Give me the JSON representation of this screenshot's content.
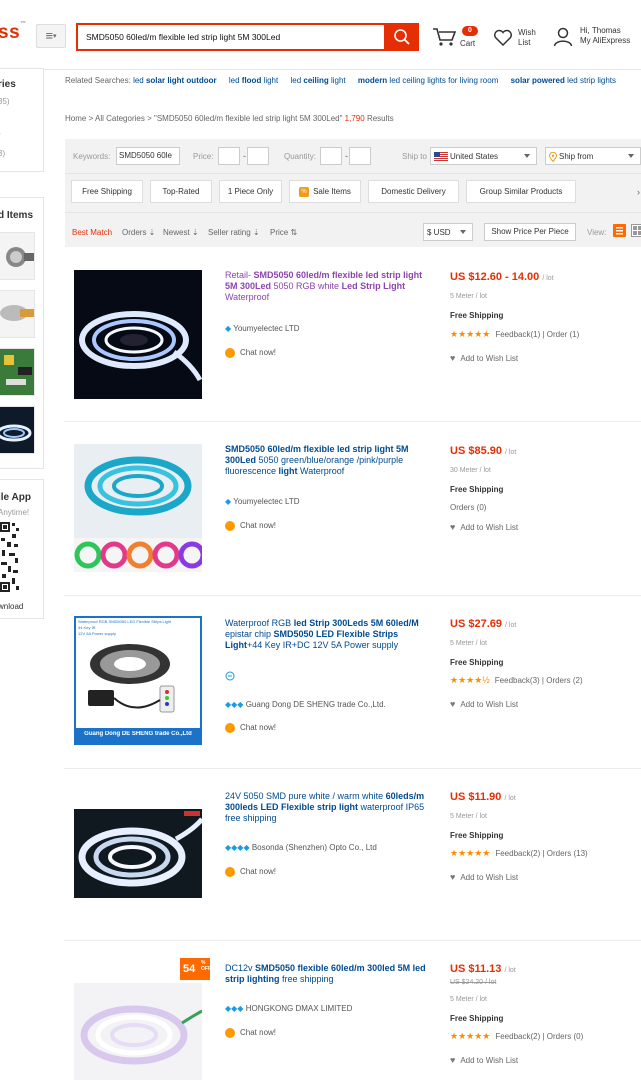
{
  "header": {
    "logo_text": "ss",
    "logo_tm": "™",
    "search_value": "SMD5050 60led/m flexible led strip light 5M 300Led",
    "cart_count": "0",
    "cart_label": "Cart",
    "wish_label": "Wish List",
    "user_greeting": "Hi, Thomas",
    "user_account": "My AliExpress",
    "brand_color": "#e62e04"
  },
  "sidebar": {
    "categories_title": "ries",
    "counts": [
      "35)",
      ")",
      "3)"
    ],
    "items_title": "d Items",
    "app_title": "ile App",
    "app_subtitle": "Anytime!",
    "download": "wnload"
  },
  "related": {
    "prefix": "Related Searches:",
    "links": [
      {
        "pre": "led ",
        "bold": "solar light outdoor",
        "post": ""
      },
      {
        "pre": "led ",
        "bold": "flood",
        "post": " light"
      },
      {
        "pre": "led ",
        "bold": "ceiling",
        "post": " light"
      },
      {
        "pre": "",
        "bold": "modern",
        "post": " led ceiling lights for living room"
      },
      {
        "pre": "",
        "bold": "solar powered",
        "post": " led strip lights"
      }
    ]
  },
  "breadcrumb": {
    "home": "Home",
    "sep": ">",
    "all": "All Categories",
    "query": "\"SMD5050 60led/m flexible led strip light 5M 300Led\"",
    "count": "1,790",
    "results": "Results"
  },
  "filters": {
    "keywords_label": "Keywords:",
    "keywords_value": "SMD5050 60le",
    "price_label": "Price:",
    "quantity_label": "Quantity:",
    "dash": "-",
    "ship_to_label": "Ship to",
    "ship_to_value": "United States",
    "ship_from_value": "Ship from",
    "chips": [
      "Free Shipping",
      "Top-Rated",
      "1 Piece Only",
      "Sale Items",
      "Domestic Delivery",
      "Group Similar Products"
    ],
    "more": "›",
    "sorts": [
      "Best Match",
      "Orders ⇣",
      "Newest ⇣",
      "Seller rating ⇣",
      "Price ⇅"
    ],
    "currency": "$ USD",
    "show_price": "Show Price Per Piece",
    "view_label": "View:"
  },
  "products": [
    {
      "title_parts": [
        {
          "t": "Retail- ",
          "b": false
        },
        {
          "t": "SMD5050 60led/m flexible led strip light 5M 300Led",
          "b": true
        },
        {
          "t": " 5050 RGB white ",
          "b": false
        },
        {
          "t": "Led Strip Light",
          "b": true
        },
        {
          "t": " Waterproof",
          "b": false
        }
      ],
      "price": "US $12.60 - 14.00",
      "unit": "/ lot",
      "qty": "5 Meter / lot",
      "shipping": "Free Shipping",
      "stars": "★★★★★",
      "feedback": "Feedback(1) | Order (1)",
      "store": "Youmyelectec LTD",
      "store_badge": "◆",
      "chat": "Chat now!",
      "wish": "Add to Wish List"
    },
    {
      "title_parts": [
        {
          "t": "SMD5050 60led/m flexible led strip light 5M 300Led",
          "b": true
        },
        {
          "t": " 5050 green/blue/orange /pink/purple fluorescence ",
          "b": false
        },
        {
          "t": "light",
          "b": true
        },
        {
          "t": " Waterproof",
          "b": false
        }
      ],
      "price": "US $85.90",
      "unit": "/ lot",
      "qty": "30 Meter / lot",
      "shipping": "Free Shipping",
      "orders": "Orders (0)",
      "store": "Youmyelectec LTD",
      "store_badge": "◆",
      "chat": "Chat now!",
      "wish": "Add to Wish List"
    },
    {
      "title_parts": [
        {
          "t": "Waterproof RGB ",
          "b": false
        },
        {
          "t": "led Strip 300Leds 5M 60led/M",
          "b": true
        },
        {
          "t": " epistar chip ",
          "b": false
        },
        {
          "t": "SMD5050 LED Flexible Strips Light",
          "b": true
        },
        {
          "t": "+44 Key IR+DC 12V 5A Power supply",
          "b": false
        }
      ],
      "price": "US $27.69",
      "unit": "/ lot",
      "qty": "5 Meter / lot",
      "shipping": "Free Shipping",
      "stars": "★★★★½",
      "feedback": "Feedback(3) | Orders (2)",
      "store": "Guang Dong DE SHENG trade Co.,Ltd.",
      "store_badge": "◆◆◆",
      "chat": "Chat now!",
      "wish": "Add to Wish List",
      "img_top_text": "Waterproof RGB SMD5050 LED Flexible Strips Light",
      "img_sub1": "44 Key IR",
      "img_sub2": "12V 5A Power supply",
      "img_banner": "Guang Dong DE SHENG trade Co.,Ltd"
    },
    {
      "title_parts": [
        {
          "t": "24V 5050 SMD pure white / warm white ",
          "b": false
        },
        {
          "t": "60leds/m 300leds LED Flexible strip light",
          "b": true
        },
        {
          "t": " waterproof IP65 free shipping",
          "b": false
        }
      ],
      "price": "US $11.90",
      "unit": "/ lot",
      "qty": "5 Meter / lot",
      "shipping": "Free Shipping",
      "stars": "★★★★★",
      "feedback": "Feedback(2) | Orders (13)",
      "store": "Bosonda (Shenzhen) Opto Co., Ltd",
      "store_badge": "◆◆◆◆",
      "chat": "Chat now!",
      "wish": "Add to Wish List"
    },
    {
      "title_parts": [
        {
          "t": "DC12v ",
          "b": false
        },
        {
          "t": "SMD5050 flexible 60led/m 300led 5M led strip lighting",
          "b": true
        },
        {
          "t": " free shipping",
          "b": false
        }
      ],
      "price": "US $11.13",
      "unit": "/ lot",
      "old_price": "US $24.20 / lot",
      "qty": "5 Meter / lot",
      "shipping": "Free Shipping",
      "stars": "★★★★★",
      "feedback": "Feedback(2) | Orders (0)",
      "store": "HONGKONG DMAX LIMITED",
      "store_badge": "◆◆◆",
      "chat": "Chat now!",
      "wish": "Add to Wish List",
      "discount": "54",
      "discount_pct": "%",
      "discount_off": "OFF"
    }
  ]
}
